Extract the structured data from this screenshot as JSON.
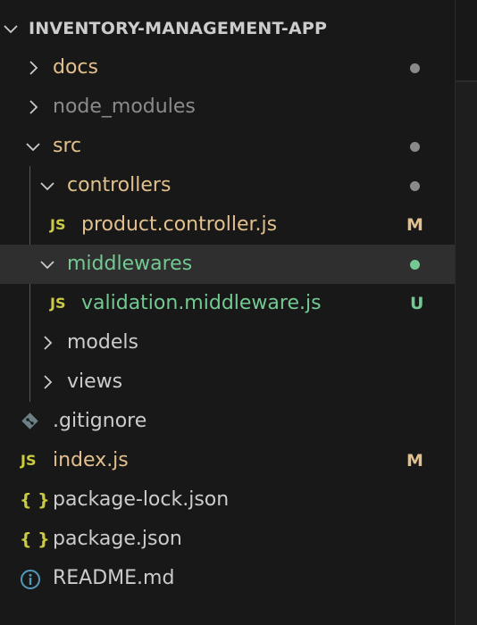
{
  "explorer": {
    "root": {
      "label": "INVENTORY-MANAGEMENT-APP"
    },
    "items": [
      {
        "label": "docs",
        "type": "folder",
        "expanded": false,
        "status": "dot",
        "color": "#e2c08d",
        "dot_color": "#8a8a8a"
      },
      {
        "label": "node_modules",
        "type": "folder",
        "expanded": false,
        "status": "",
        "color": "#8b8b8b"
      },
      {
        "label": "src",
        "type": "folder",
        "expanded": true,
        "status": "dot",
        "color": "#e2c08d",
        "dot_color": "#8a8a8a"
      },
      {
        "label": "controllers",
        "type": "folder",
        "expanded": true,
        "status": "dot",
        "color": "#e2c08d",
        "dot_color": "#8a8a8a"
      },
      {
        "label": "product.controller.js",
        "type": "file",
        "icon": "JS",
        "status": "M",
        "color": "#e2c08d"
      },
      {
        "label": "middlewares",
        "type": "folder",
        "expanded": true,
        "status": "dot",
        "color": "#73c991",
        "dot_color": "#73c991",
        "selected": true
      },
      {
        "label": "validation.middleware.js",
        "type": "file",
        "icon": "JS",
        "status": "U",
        "color": "#73c991"
      },
      {
        "label": "models",
        "type": "folder",
        "expanded": false,
        "status": "",
        "color": "#cccccc"
      },
      {
        "label": "views",
        "type": "folder",
        "expanded": false,
        "status": "",
        "color": "#cccccc"
      },
      {
        "label": ".gitignore",
        "type": "file",
        "icon": "git-icon",
        "status": "",
        "color": "#cccccc"
      },
      {
        "label": "index.js",
        "type": "file",
        "icon": "JS",
        "status": "M",
        "color": "#e2c08d"
      },
      {
        "label": "package-lock.json",
        "type": "file",
        "icon": "{ }",
        "status": "",
        "color": "#cccccc"
      },
      {
        "label": "package.json",
        "type": "file",
        "icon": "{ }",
        "status": "",
        "color": "#cccccc"
      },
      {
        "label": "README.md",
        "type": "file",
        "icon": "info-icon",
        "status": "",
        "color": "#cccccc"
      }
    ]
  },
  "colors": {
    "background": "#181818",
    "selected_row": "#2f2f30",
    "modified": "#e2c08d",
    "untracked": "#73c991",
    "js_icon": "#cbcb41",
    "json_icon": "#cbcb41",
    "info_icon": "#519aba",
    "git_icon": "#6d8086"
  }
}
